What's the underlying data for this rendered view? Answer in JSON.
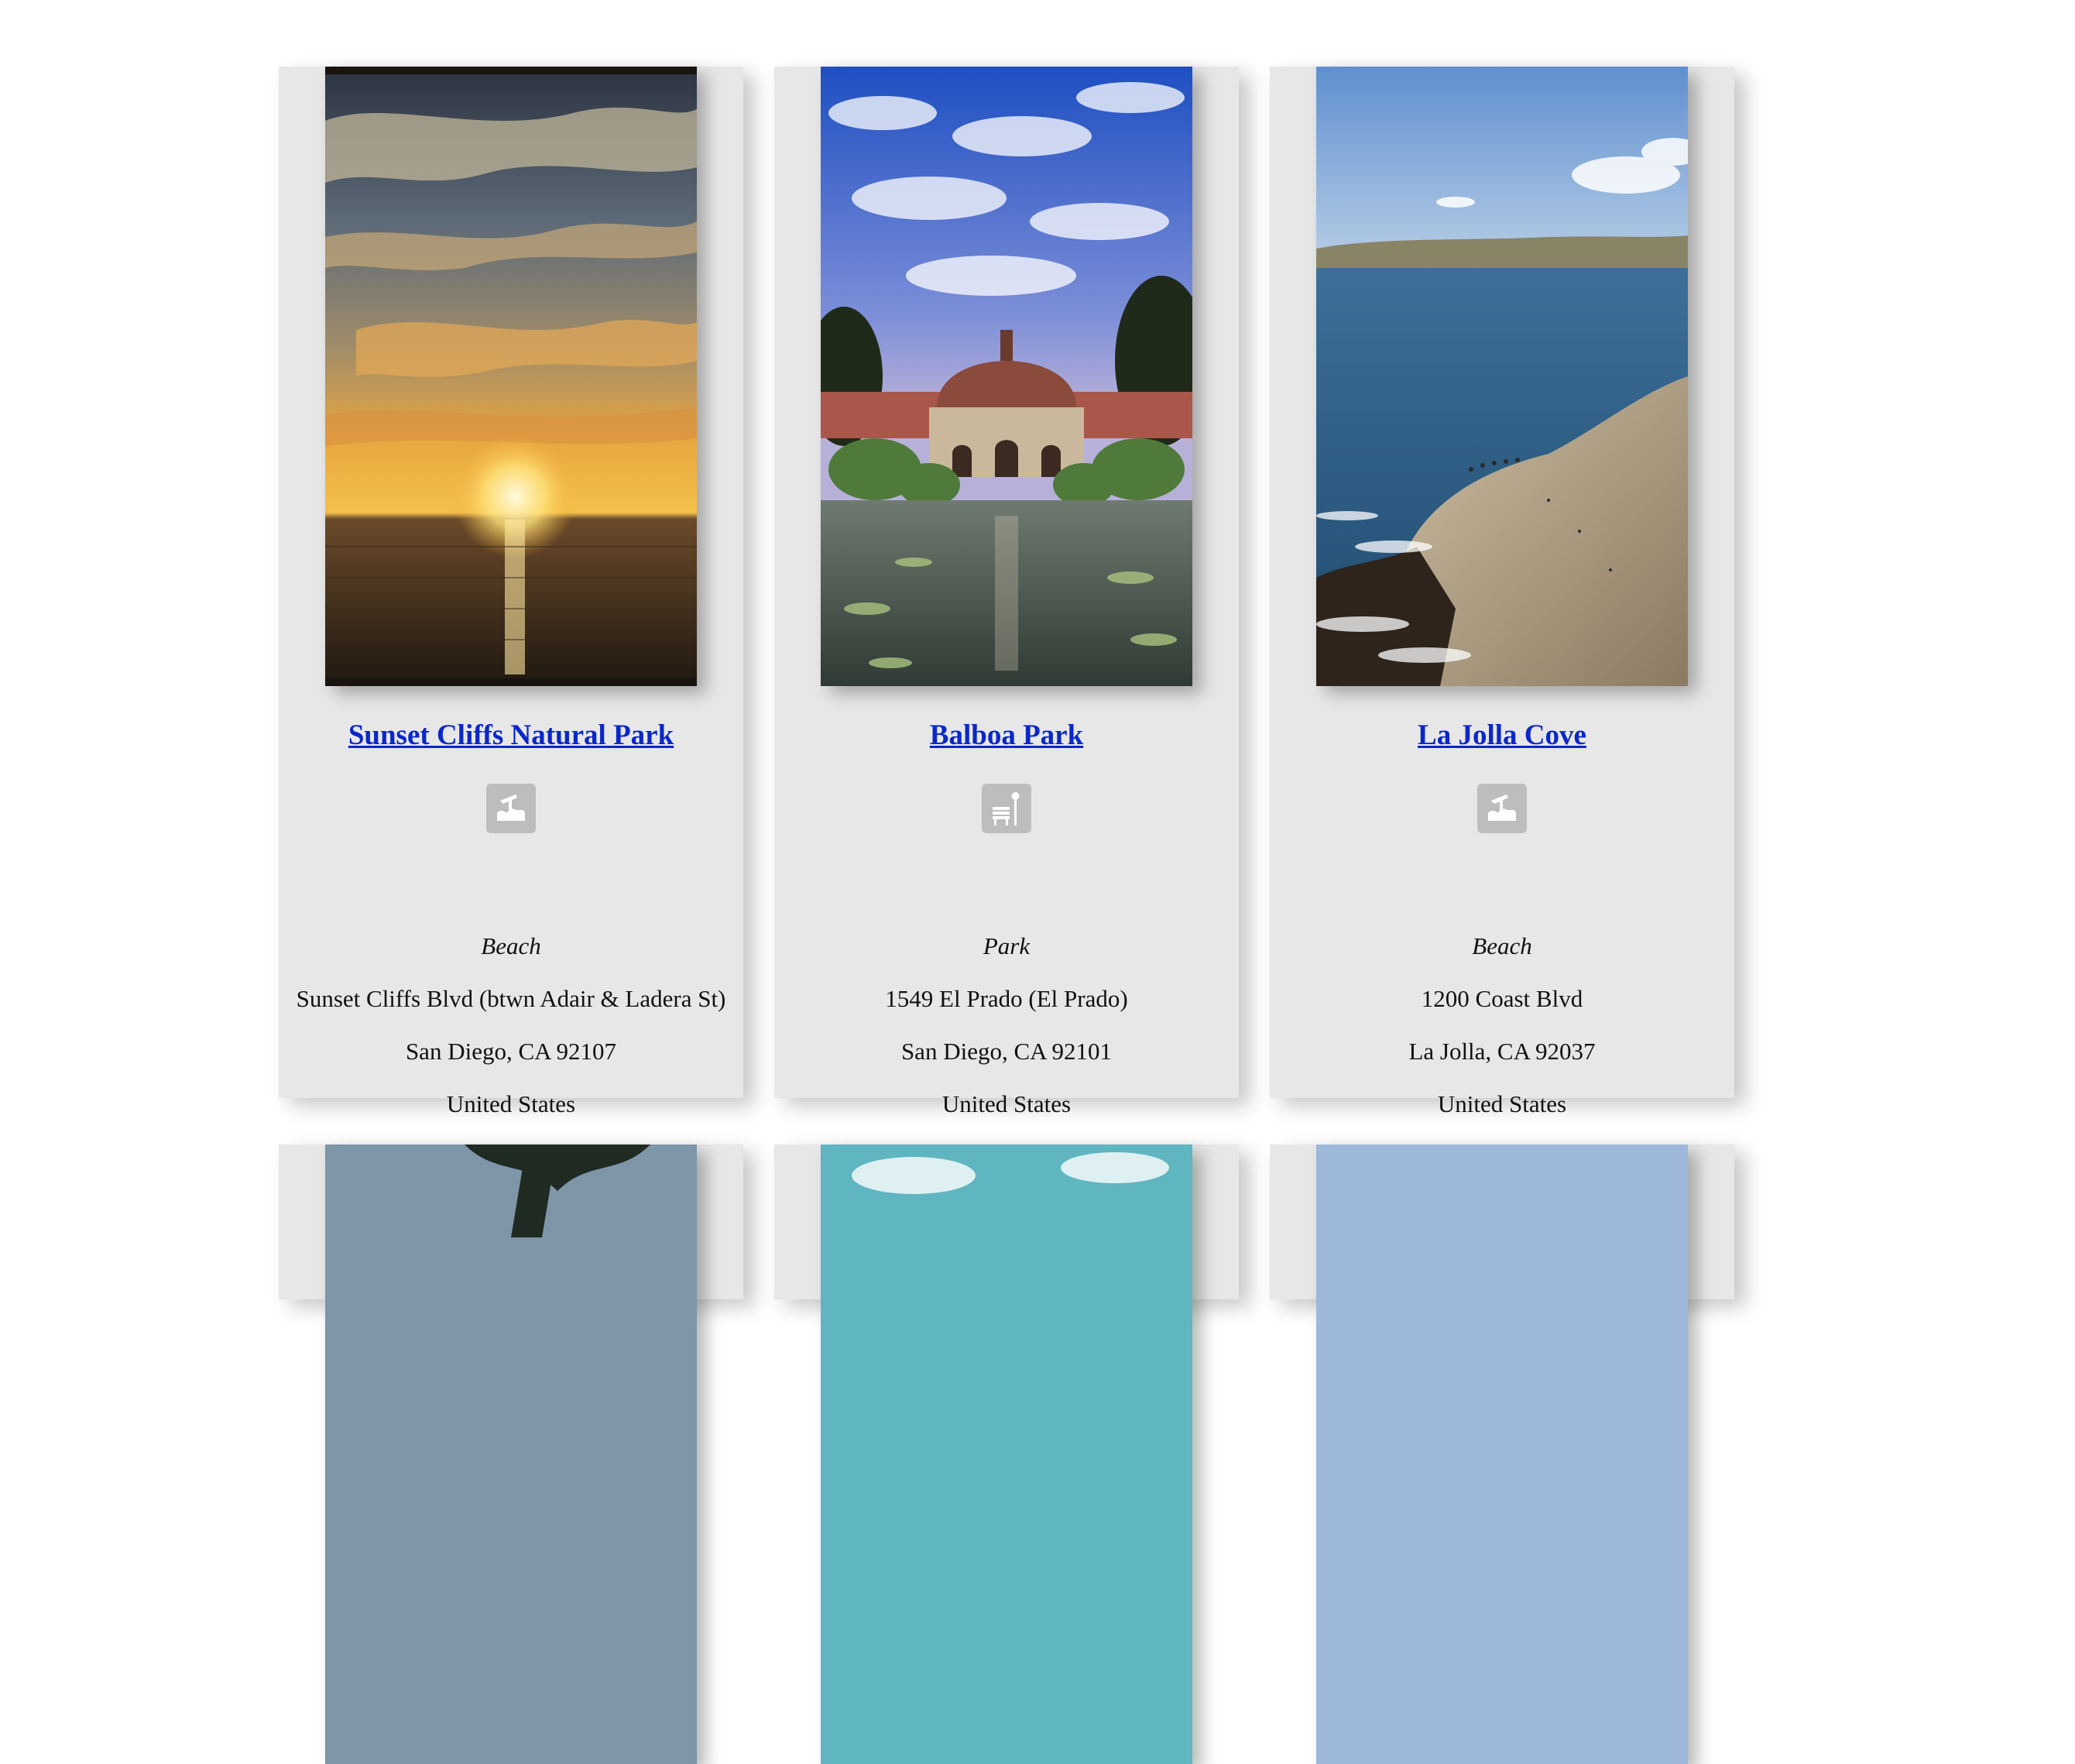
{
  "places": [
    {
      "name": "Sunset Cliffs Natural Park",
      "category": "Beach",
      "category_icon": "beach-icon",
      "address_line1": "Sunset Cliffs Blvd (btwn Adair & Ladera St)",
      "address_line2": "San Diego, CA 92107",
      "country": "United States",
      "photo": "sunset-over-ocean-photo"
    },
    {
      "name": "Balboa Park",
      "category": "Park",
      "category_icon": "park-bench-icon",
      "address_line1": "1549 El Prado (El Prado)",
      "address_line2": "San Diego, CA 92101",
      "country": "United States",
      "photo": "botanical-building-photo"
    },
    {
      "name": "La Jolla Cove",
      "category": "Beach",
      "category_icon": "beach-icon",
      "address_line1": "1200 Coast Blvd",
      "address_line2": "La Jolla, CA 92037",
      "country": "United States",
      "photo": "coastal-cliffs-photo"
    }
  ],
  "next_row_photos": [
    "palm-tree-photo",
    "sky-clouds-photo",
    "blue-sky-photo"
  ],
  "colors": {
    "card_background": "#e7e7e7",
    "link": "#0a27c9",
    "icon_background": "#bdbdbd"
  }
}
